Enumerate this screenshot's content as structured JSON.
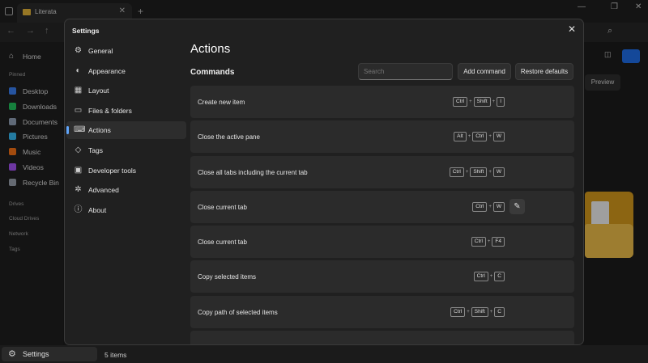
{
  "explorer": {
    "tab_title": "Literata",
    "tab_close": "✕",
    "new_tab": "+",
    "minimize": "—",
    "maximize": "❐",
    "close": "✕",
    "sidebar": {
      "home": "Home",
      "pinned_header": "Pinned",
      "pinned": [
        {
          "label": "Desktop",
          "color": "#3b82f6"
        },
        {
          "label": "Downloads",
          "color": "#22c55e"
        },
        {
          "label": "Documents",
          "color": "#94a3b8"
        },
        {
          "label": "Pictures",
          "color": "#38bdf8"
        },
        {
          "label": "Music",
          "color": "#f97316"
        },
        {
          "label": "Videos",
          "color": "#a855f7"
        },
        {
          "label": "Recycle Bin",
          "color": "#9ca3af"
        }
      ],
      "drives": "Drives",
      "cloud_drives": "Cloud Drives",
      "network": "Network",
      "tags": "Tags"
    },
    "preview_button": "Preview",
    "status": {
      "settings": "Settings",
      "item_count": "5 items"
    }
  },
  "settings": {
    "title": "Settings",
    "close": "✕",
    "menu": [
      {
        "label": "General",
        "icon": "sliders-icon",
        "glyph": "⚙",
        "active": false
      },
      {
        "label": "Appearance",
        "icon": "palette-icon",
        "glyph": "◐",
        "active": false
      },
      {
        "label": "Layout",
        "icon": "layout-grid-icon",
        "glyph": "▦",
        "active": false
      },
      {
        "label": "Files & folders",
        "icon": "folder-icon",
        "glyph": "▭",
        "active": false
      },
      {
        "label": "Actions",
        "icon": "keyboard-icon",
        "glyph": "⌨",
        "active": true
      },
      {
        "label": "Tags",
        "icon": "tag-icon",
        "glyph": "◇",
        "active": false
      },
      {
        "label": "Developer tools",
        "icon": "developer-tools-icon",
        "glyph": "▣",
        "active": false
      },
      {
        "label": "Advanced",
        "icon": "advanced-icon",
        "glyph": "✲",
        "active": false
      },
      {
        "label": "About",
        "icon": "info-icon",
        "glyph": "ⓘ",
        "active": false
      }
    ],
    "page_title": "Actions",
    "section_title": "Commands",
    "search_placeholder": "Search",
    "add_command": "Add command",
    "restore_defaults": "Restore defaults",
    "commands": [
      {
        "label": "Create new item",
        "keys": [
          "Ctrl",
          "Shift",
          "I"
        ],
        "edit": false
      },
      {
        "label": "Close the active pane",
        "keys": [
          "Alt",
          "Ctrl",
          "W"
        ],
        "edit": false
      },
      {
        "label": "Close all tabs including the current tab",
        "keys": [
          "Ctrl",
          "Shift",
          "W"
        ],
        "edit": false
      },
      {
        "label": "Close current tab",
        "keys": [
          "Ctrl",
          "W"
        ],
        "edit": true
      },
      {
        "label": "Close current tab",
        "keys": [
          "Ctrl",
          "F4"
        ],
        "edit": false
      },
      {
        "label": "Copy selected items",
        "keys": [
          "Ctrl",
          "C"
        ],
        "edit": false
      },
      {
        "label": "Copy path of selected items",
        "keys": [
          "Ctrl",
          "Shift",
          "C"
        ],
        "edit": false
      }
    ]
  }
}
